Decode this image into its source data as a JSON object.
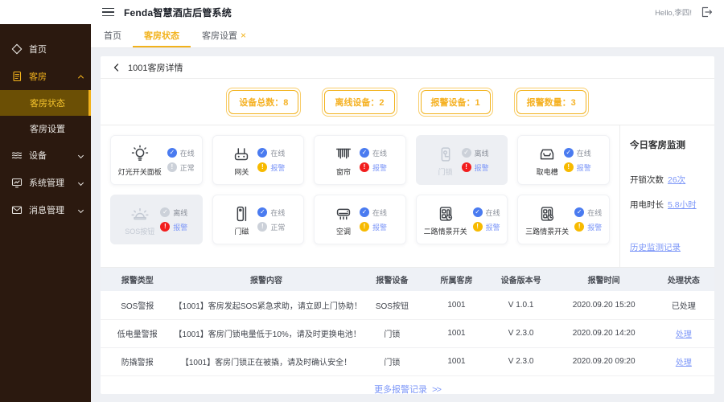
{
  "theme": {
    "accent": "#f2b21c",
    "accentLight": "#f8cd6a",
    "accentText": "#f5b226",
    "blue": "#4a7bf0",
    "linkBlue": "#7d97f8",
    "red": "#f21d1d",
    "warnYellow": "#f7ba00",
    "grayDot": "#ccd1d9",
    "sidebarBg": "#2b190f",
    "sidebarActiveBg": "#6b4f05",
    "sidebarActiveText": "#f7c52d",
    "pageBg": "#eef0f4",
    "tableHeaderBg": "#eef1f6",
    "disabledBg": "#edeff3"
  },
  "header": {
    "title": "Fenda智慧酒店后管系统",
    "greeting": "Hello,李四!"
  },
  "sidebar": {
    "items": [
      {
        "label": "首页",
        "icon": "home-icon"
      },
      {
        "label": "客房",
        "icon": "rooms-icon",
        "expanded": true
      },
      {
        "label": "客房状态",
        "active": true
      },
      {
        "label": "客房设置"
      },
      {
        "label": "设备",
        "icon": "devices-icon"
      },
      {
        "label": "系统管理",
        "icon": "system-icon"
      },
      {
        "label": "消息管理",
        "icon": "messages-icon"
      }
    ]
  },
  "tabs": [
    {
      "label": "首页"
    },
    {
      "label": "客房状态",
      "active": true
    },
    {
      "label": "客房设置",
      "close": "×"
    }
  ],
  "breadcrumb": {
    "title": "1001客房详情"
  },
  "stats": [
    {
      "label": "设备总数：",
      "value": "8"
    },
    {
      "label": "离线设备：",
      "value": "2"
    },
    {
      "label": "报警设备：",
      "value": "1"
    },
    {
      "label": "报警数量：",
      "value": "3"
    }
  ],
  "devices": [
    {
      "name": "灯光开关面板",
      "icon": "bulb-icon",
      "disabled": false,
      "online": {
        "label": "在线",
        "state": "online"
      },
      "alarm": {
        "label": "正常",
        "state": "normal"
      }
    },
    {
      "name": "网关",
      "icon": "gateway-icon",
      "disabled": false,
      "online": {
        "label": "在线",
        "state": "online"
      },
      "alarm": {
        "label": "报警",
        "state": "warning"
      }
    },
    {
      "name": "窗帘",
      "icon": "curtain-icon",
      "disabled": false,
      "online": {
        "label": "在线",
        "state": "online"
      },
      "alarm": {
        "label": "报警",
        "state": "danger"
      }
    },
    {
      "name": "门锁",
      "icon": "door-lock-icon",
      "disabled": true,
      "online": {
        "label": "离线",
        "state": "offline"
      },
      "alarm": {
        "label": "报警",
        "state": "danger"
      }
    },
    {
      "name": "取电槽",
      "icon": "power-slot-icon",
      "disabled": false,
      "online": {
        "label": "在线",
        "state": "online"
      },
      "alarm": {
        "label": "报警",
        "state": "warning"
      }
    },
    {
      "name": "SOS按钮",
      "icon": "sos-siren-icon",
      "disabled": true,
      "online": {
        "label": "离线",
        "state": "offline"
      },
      "alarm": {
        "label": "报警",
        "state": "danger"
      }
    },
    {
      "name": "门磁",
      "icon": "door-magnet-icon",
      "disabled": false,
      "online": {
        "label": "在线",
        "state": "online"
      },
      "alarm": {
        "label": "正常",
        "state": "normal"
      }
    },
    {
      "name": "空调",
      "icon": "ac-icon",
      "disabled": false,
      "online": {
        "label": "在线",
        "state": "online"
      },
      "alarm": {
        "label": "报警",
        "state": "warning"
      }
    },
    {
      "name": "二路情景开关",
      "icon": "scene-switch-icon",
      "disabled": false,
      "online": {
        "label": "在线",
        "state": "online"
      },
      "alarm": {
        "label": "报警",
        "state": "warning"
      }
    },
    {
      "name": "三路情景开关",
      "icon": "scene-switch-icon",
      "disabled": false,
      "online": {
        "label": "在线",
        "state": "online"
      },
      "alarm": {
        "label": "报警",
        "state": "warning"
      }
    }
  ],
  "monitor": {
    "title": "今日客房监测",
    "metrics": [
      {
        "label": "开锁次数",
        "value": "26次"
      },
      {
        "label": "用电时长",
        "value": "5.8小时"
      }
    ],
    "history": "历史监测记录"
  },
  "alarm_table": {
    "headers": [
      "报警类型",
      "报警内容",
      "报警设备",
      "所属客房",
      "设备版本号",
      "报警时间",
      "处理状态"
    ],
    "rows": [
      {
        "type": "SOS警报",
        "content": "【1001】客房发起SOS紧急求助，请立即上门协助！",
        "device": "SOS按钮",
        "room": "1001",
        "version": "V 1.0.1",
        "time": "2020.09.20 15:20",
        "status": "已处理",
        "status_is_link": false
      },
      {
        "type": "低电量警报",
        "content": "【1001】客房门锁电量低于10%，请及时更换电池！",
        "device": "门锁",
        "room": "1001",
        "version": "V 2.3.0",
        "time": "2020.09.20 14:20",
        "status": "处理",
        "status_is_link": true
      },
      {
        "type": "防撬警报",
        "content": "【1001】客房门锁正在被撬，请及时确认安全！",
        "device": "门锁",
        "room": "1001",
        "version": "V 2.3.0",
        "time": "2020.09.20 09:20",
        "status": "处理",
        "status_is_link": true
      }
    ]
  },
  "footer": {
    "more": "更多报警记录",
    "arrow": ">>"
  }
}
